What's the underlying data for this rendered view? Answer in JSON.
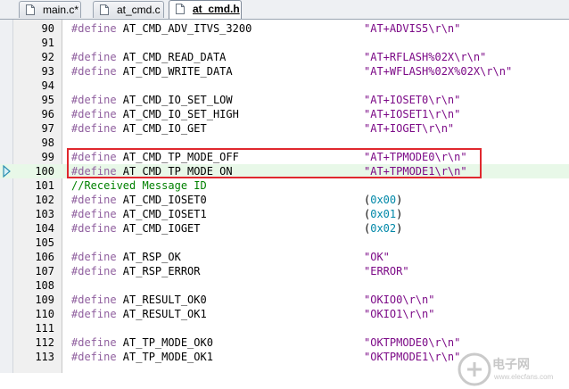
{
  "tabs": [
    {
      "label": "main.c*",
      "active": false
    },
    {
      "label": "at_cmd.c",
      "active": false
    },
    {
      "label": "at_cmd.h",
      "active": true
    }
  ],
  "editor": {
    "current_line": "100",
    "lines": [
      {
        "no": "90",
        "kw": "#define",
        "name": " AT_CMD_ADV_ITVS_3200",
        "value": "\"AT+ADVIS5\\r\\n\""
      },
      {
        "no": "91"
      },
      {
        "no": "92",
        "kw": "#define",
        "name": " AT_CMD_READ_DATA",
        "value": "\"AT+RFLASH%02X\\r\\n\""
      },
      {
        "no": "93",
        "kw": "#define",
        "name": " AT_CMD_WRITE_DATA",
        "value": "\"AT+WFLASH%02X%02X\\r\\n\""
      },
      {
        "no": "94"
      },
      {
        "no": "95",
        "kw": "#define",
        "name": " AT_CMD_IO_SET_LOW",
        "value": "\"AT+IOSET0\\r\\n\""
      },
      {
        "no": "96",
        "kw": "#define",
        "name": " AT_CMD_IO_SET_HIGH",
        "value": "\"AT+IOSET1\\r\\n\""
      },
      {
        "no": "97",
        "kw": "#define",
        "name": " AT_CMD_IO_GET",
        "value": "\"AT+IOGET\\r\\n\""
      },
      {
        "no": "98"
      },
      {
        "no": "99",
        "kw": "#define",
        "name": " AT_CMD_TP_MODE_OFF",
        "value": "\"AT+TPMODE0\\r\\n\""
      },
      {
        "no": "100",
        "kw": "#define",
        "name": " AT_CMD_TP_MODE_ON",
        "value": "\"AT+TPMODE1\\r\\n\""
      },
      {
        "no": "101",
        "comment": "//Received Message ID"
      },
      {
        "no": "102",
        "kw": "#define",
        "name": " AT_CMD_IOSET0",
        "open": "(",
        "num": "0x00",
        "close": ")"
      },
      {
        "no": "103",
        "kw": "#define",
        "name": " AT_CMD_IOSET1",
        "open": "(",
        "num": "0x01",
        "close": ")"
      },
      {
        "no": "104",
        "kw": "#define",
        "name": " AT_CMD_IOGET",
        "open": "(",
        "num": "0x02",
        "close": ")"
      },
      {
        "no": "105"
      },
      {
        "no": "106",
        "kw": "#define",
        "name": " AT_RSP_OK",
        "value": "\"OK\""
      },
      {
        "no": "107",
        "kw": "#define",
        "name": " AT_RSP_ERROR",
        "value": "\"ERROR\""
      },
      {
        "no": "108"
      },
      {
        "no": "109",
        "kw": "#define",
        "name": " AT_RESULT_OK0",
        "value": "\"OKIO0\\r\\n\""
      },
      {
        "no": "110",
        "kw": "#define",
        "name": " AT_RESULT_OK1",
        "value": "\"OKIO1\\r\\n\""
      },
      {
        "no": "111"
      },
      {
        "no": "112",
        "kw": "#define",
        "name": " AT_TP_MODE_OK0",
        "value": "\"OKTPMODE0\\r\\n\""
      },
      {
        "no": "113",
        "kw": "#define",
        "name": " AT_TP_MODE_OK1",
        "value": "\"OKTPMODE1\\r\\n\""
      }
    ]
  },
  "watermark": {
    "text": "电子网",
    "sub": "www.elecfans.com",
    "logo": "21ic"
  },
  "colors": {
    "keyword": "#8f5e9e",
    "string": "#7c0a87",
    "number": "#0088a8",
    "comment": "#008000",
    "highlight_box": "#e0282e",
    "current_line_bg": "#e8f8e8"
  },
  "icons": {
    "tab_file": "document-icon",
    "exec_marker": "arrow-marker-icon"
  }
}
